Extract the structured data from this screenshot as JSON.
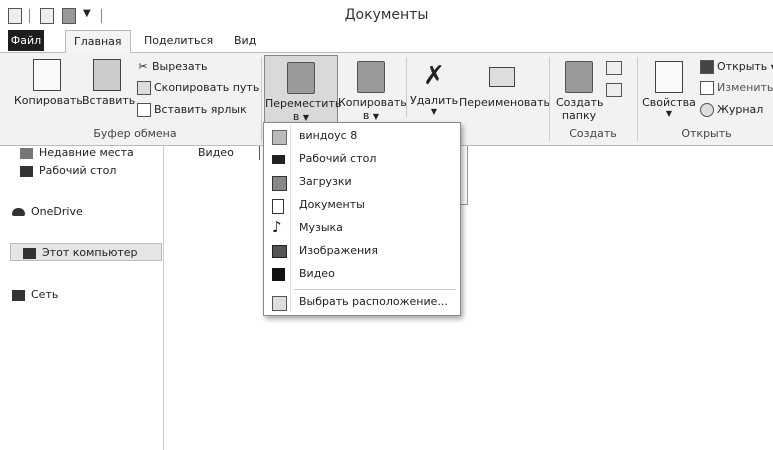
{
  "window": {
    "title": "Документы"
  },
  "tabs": {
    "file": "Файл",
    "home": "Главная",
    "share": "Поделиться",
    "view": "Вид"
  },
  "clipboard": {
    "copy": "Копировать",
    "paste": "Вставить",
    "cut": "Вырезать",
    "copy_path": "Скопировать путь",
    "paste_shortcut": "Вставить ярлык",
    "group": "Буфер обмена"
  },
  "organize": {
    "move_to_line1": "Переместить",
    "move_to_line2": "в",
    "copy_to_line1": "Копировать",
    "copy_to_line2": "в",
    "delete": "Удалить",
    "rename": "Переименовать"
  },
  "new": {
    "new_folder_line1": "Создать",
    "new_folder_line2": "папку",
    "group": "Создать"
  },
  "open": {
    "properties": "Свойства",
    "open": "Открыть",
    "edit": "Изменить",
    "history": "Журнал",
    "group": "Открыть"
  },
  "nav": {
    "recent": "Недавние места",
    "desktop": "Рабочий стол",
    "onedrive": "OneDrive",
    "this_pc": "Этот компьютер",
    "network": "Сеть"
  },
  "content": {
    "item": "Видео"
  },
  "move_menu": {
    "items": [
      "виндоус 8",
      "Рабочий стол",
      "Загрузки",
      "Документы",
      "Музыка",
      "Изображения",
      "Видео"
    ],
    "choose": "Выбрать расположение..."
  }
}
